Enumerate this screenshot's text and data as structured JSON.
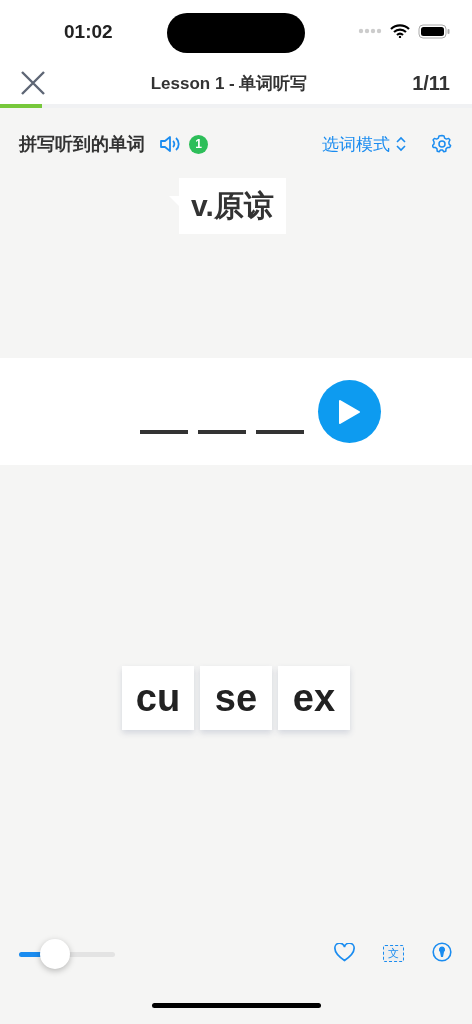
{
  "status_bar": {
    "time": "01:02"
  },
  "nav": {
    "title": "Lesson 1 - 单词听写",
    "counter": "1/11",
    "progress": {
      "level": 0.09
    }
  },
  "prompt": {
    "instruction": "拼写听到的单词",
    "play_count": "1",
    "mode": "选词模式",
    "hint": "v.原谅"
  },
  "answer_slots": [
    {
      "kind": "blank"
    },
    {
      "kind": "blank"
    },
    {
      "kind": "blank"
    }
  ],
  "tiles": [
    {
      "label": "cu"
    },
    {
      "label": "se"
    },
    {
      "label": "ex"
    }
  ],
  "bottom": {
    "speed": {
      "level": 0.375
    },
    "translate_glyph": "文"
  }
}
